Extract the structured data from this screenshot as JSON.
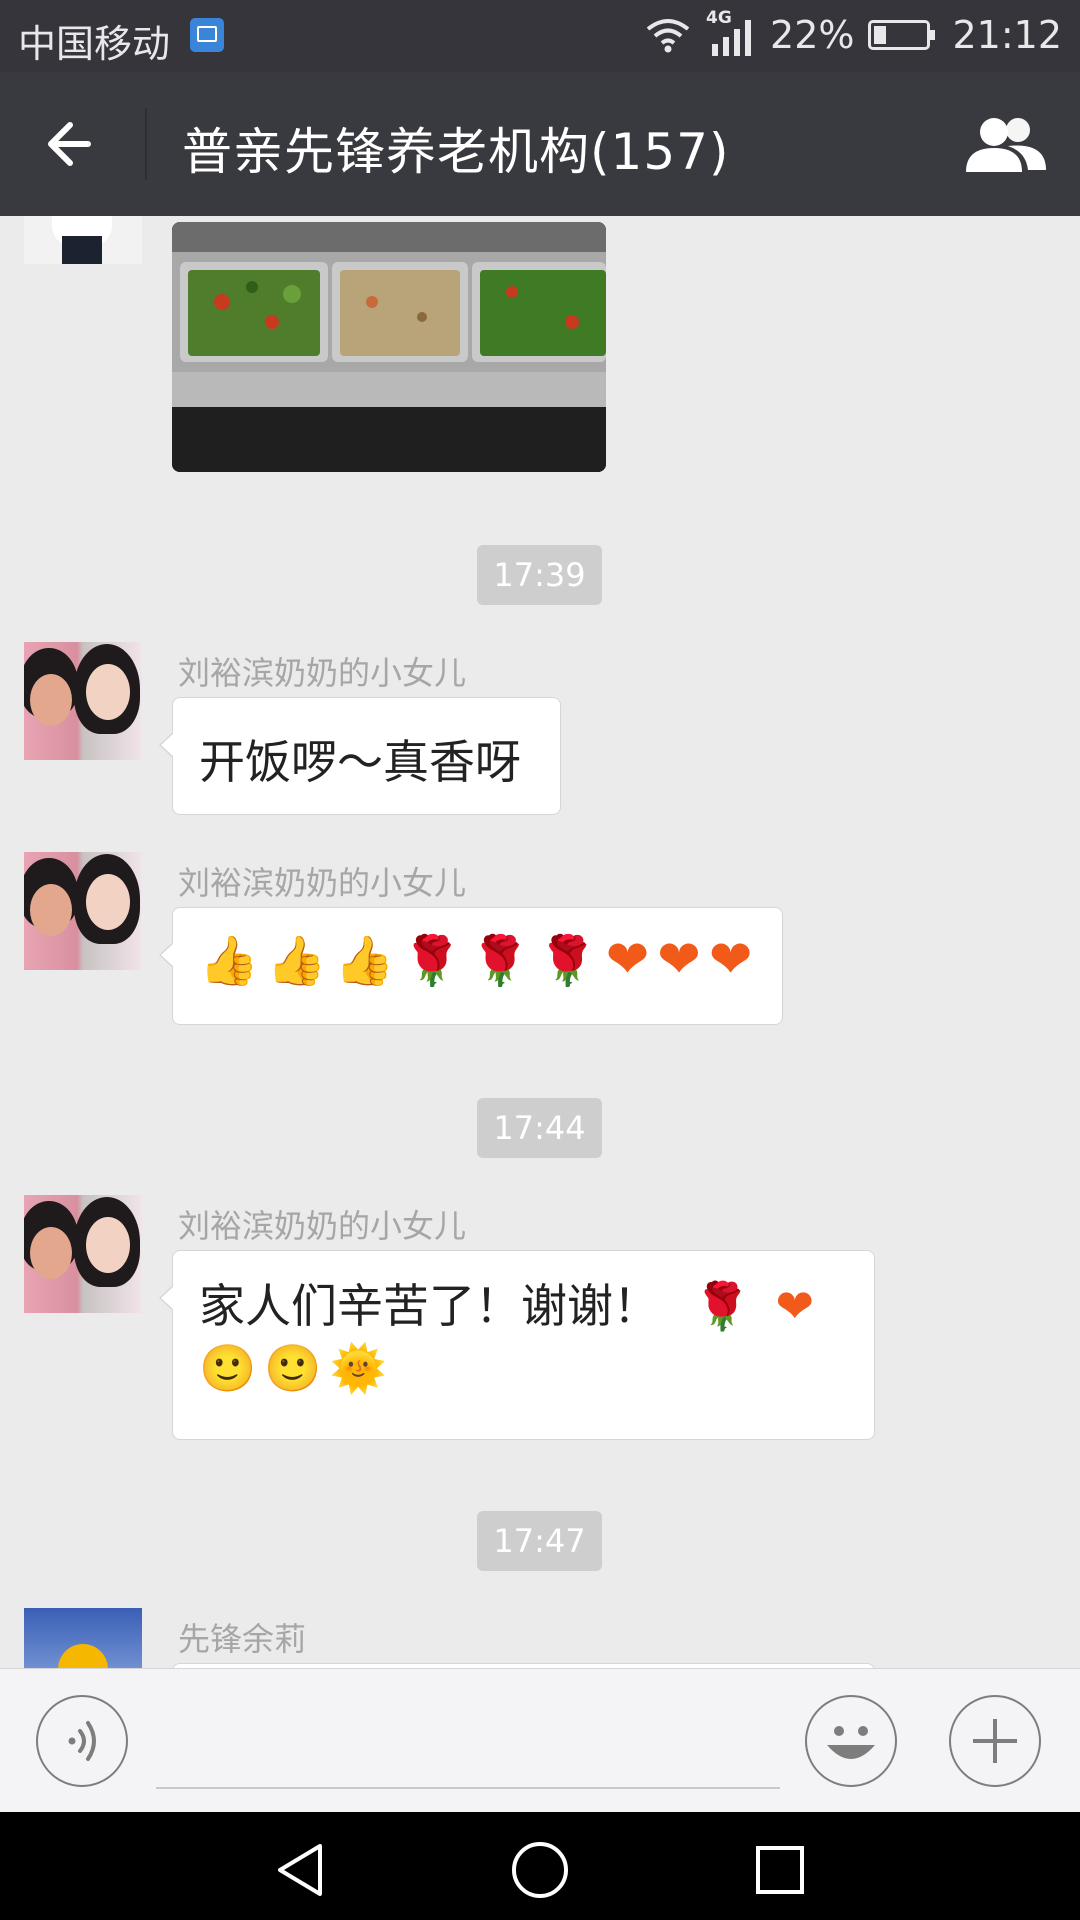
{
  "status_bar": {
    "carrier": "中国移动",
    "network": "4G",
    "battery": "22%",
    "time": "21:12",
    "icons": [
      "gallery-notification-icon",
      "wifi-icon",
      "signal-icon",
      "battery-icon"
    ]
  },
  "header": {
    "title": "普亲先锋养老机构(157)",
    "icons": [
      "back-arrow-icon",
      "group-members-icon"
    ]
  },
  "messages": [
    {
      "type": "image",
      "description_icon": "food-tray-photo"
    },
    {
      "type": "time",
      "text": "17:39"
    },
    {
      "type": "text",
      "sender": "刘裕滨奶奶的小女儿",
      "text": "开饭啰～真香呀"
    },
    {
      "type": "emoji",
      "sender": "刘裕滨奶奶的小女儿",
      "emojis": [
        "👍",
        "👍",
        "👍",
        "🌹",
        "🌹",
        "🌹",
        "❤",
        "❤",
        "❤"
      ]
    },
    {
      "type": "time",
      "text": "17:44"
    },
    {
      "type": "text",
      "sender": "刘裕滨奶奶的小女儿",
      "text": "家人们辛苦了！谢谢！",
      "emojis_line1": [
        "🌹",
        "❤"
      ],
      "emojis_line2": [
        "🙂",
        "🙂",
        "🌞"
      ]
    },
    {
      "type": "time",
      "text": "17:47"
    },
    {
      "type": "text",
      "sender": "先锋余莉",
      "text": ""
    }
  ],
  "input_bar": {
    "icons": [
      "voice-input-icon",
      "emoji-icon",
      "plus-icon"
    ]
  },
  "nav_bar": {
    "icons": [
      "nav-back-icon",
      "nav-home-icon",
      "nav-recents-icon"
    ]
  },
  "colors": {
    "status_bar": "#35353b",
    "title_bar": "#393a3f",
    "chat_bg": "#ebebeb",
    "time_pill": "#cecece"
  }
}
